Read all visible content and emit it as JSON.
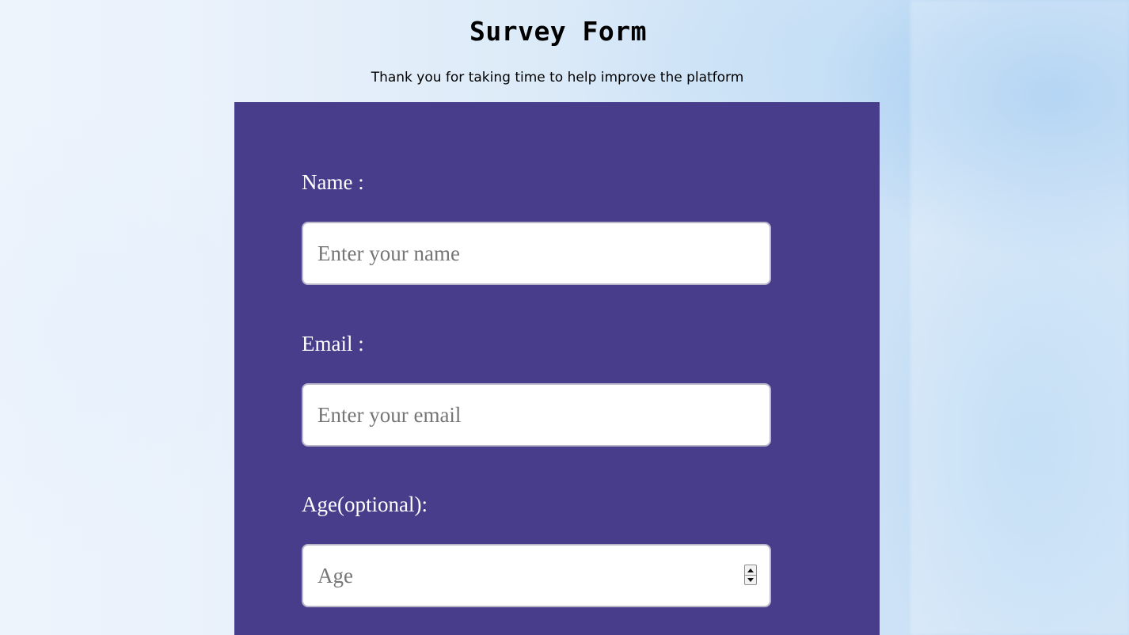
{
  "header": {
    "title": "Survey Form",
    "subtitle": "Thank you for taking time to help improve the platform"
  },
  "form": {
    "background_color": "#483d8b",
    "fields": {
      "name": {
        "label": "Name :",
        "placeholder": "Enter your name",
        "value": ""
      },
      "email": {
        "label": "Email :",
        "placeholder": "Enter your email",
        "value": ""
      },
      "age": {
        "label": "Age(optional):",
        "placeholder": "Age",
        "value": "",
        "stepper_icon": "number-stepper-icon"
      }
    }
  }
}
